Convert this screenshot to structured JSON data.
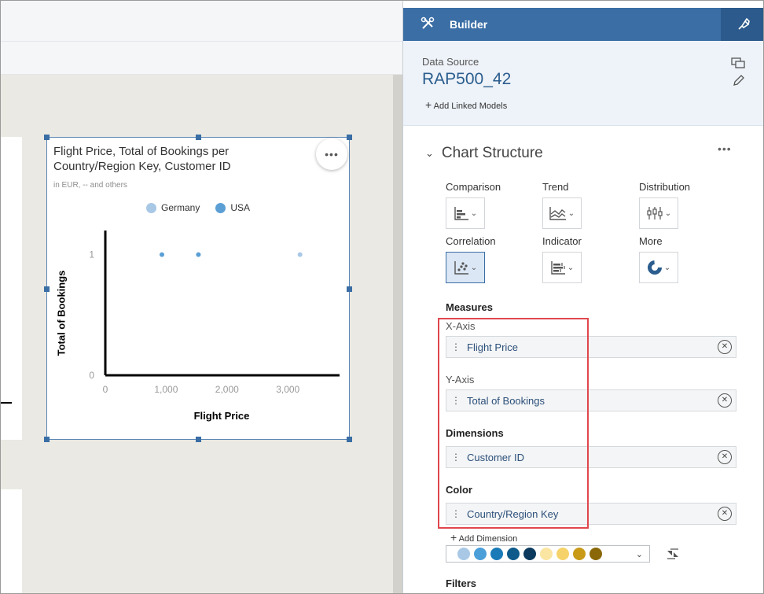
{
  "widget": {
    "title": "Flight Price, Total of Bookings per Country/Region Key, Customer ID",
    "subtitle": "in EUR, -- and others",
    "legend": [
      {
        "label": "Germany",
        "color": "#a8c8e6"
      },
      {
        "label": "USA",
        "color": "#5b9fd4"
      }
    ]
  },
  "chart_data": {
    "type": "scatter",
    "xlabel": "Flight Price",
    "ylabel": "Total of Bookings",
    "x_ticks": [
      "0",
      "1,000",
      "2,000",
      "3,000"
    ],
    "y_ticks": [
      "0",
      "1"
    ],
    "xlim": [
      0,
      3850
    ],
    "ylim": [
      0,
      1.2
    ],
    "series": [
      {
        "name": "USA",
        "color": "#5b9fd4",
        "points": [
          {
            "x": 930,
            "y": 1
          },
          {
            "x": 1530,
            "y": 1
          }
        ]
      },
      {
        "name": "Germany",
        "color": "#a8c8e6",
        "points": [
          {
            "x": 3200,
            "y": 1
          }
        ]
      }
    ]
  },
  "builder": {
    "title": "Builder",
    "data_source_label": "Data Source",
    "data_source_name": "RAP500_42",
    "add_linked_models": "Add Linked Models",
    "chart_structure": "Chart Structure",
    "chart_types": [
      {
        "label": "Comparison",
        "icon": "bar-chart-icon"
      },
      {
        "label": "Trend",
        "icon": "area-chart-icon"
      },
      {
        "label": "Distribution",
        "icon": "boxplot-icon"
      },
      {
        "label": "Correlation",
        "icon": "scatter-chart-icon"
      },
      {
        "label": "Indicator",
        "icon": "bullet-chart-icon"
      },
      {
        "label": "More",
        "icon": "donut-chart-icon"
      }
    ],
    "measures": "Measures",
    "x_axis": "X-Axis",
    "x_axis_value": "Flight Price",
    "y_axis": "Y-Axis",
    "y_axis_value": "Total of Bookings",
    "dimensions": "Dimensions",
    "dimension_value": "Customer ID",
    "color": "Color",
    "color_value": "Country/Region Key",
    "add_dimension": "Add Dimension",
    "palette": [
      "#a8c8e6",
      "#4a9fd8",
      "#1a7ab8",
      "#0e5a8a",
      "#0b3a5e",
      "#fbe5a2",
      "#f6d36a",
      "#c89a16",
      "#8a6808"
    ],
    "filters": "Filters"
  },
  "colors": {
    "accent": "#3b6ea5",
    "highlight": "#e0474e"
  }
}
